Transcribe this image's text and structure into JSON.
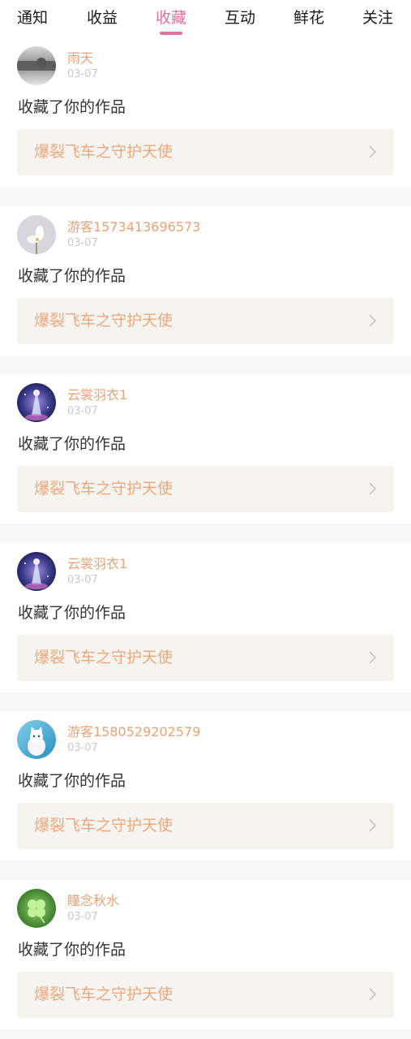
{
  "tabs": [
    {
      "label": "通知"
    },
    {
      "label": "收益"
    },
    {
      "label": "收藏",
      "active": true
    },
    {
      "label": "互动"
    },
    {
      "label": "鲜花"
    },
    {
      "label": "关注"
    }
  ],
  "colors": {
    "accent": "#e0719b",
    "username": "#e8a274",
    "work_title": "#eba87f",
    "work_bg": "#f5f4ef"
  },
  "feed": [
    {
      "user": "雨天",
      "date": "03-07",
      "action": "收藏了你的作品",
      "work": "爆裂飞车之守护天使",
      "avatar": "grayscale-photo-avatar"
    },
    {
      "user": "游客1573413696573",
      "date": "03-07",
      "action": "收藏了你的作品",
      "work": "爆裂飞车之守护天使",
      "avatar": "white-flower-avatar"
    },
    {
      "user": "云裳羽衣1",
      "date": "03-07",
      "action": "收藏了你的作品",
      "work": "爆裂飞车之守护天使",
      "avatar": "galaxy-angel-avatar"
    },
    {
      "user": "云裳羽衣1",
      "date": "03-07",
      "action": "收藏了你的作品",
      "work": "爆裂飞车之守护天使",
      "avatar": "galaxy-angel-avatar"
    },
    {
      "user": "游客1580529202579",
      "date": "03-07",
      "action": "收藏了你的作品",
      "work": "爆裂飞车之守护天使",
      "avatar": "white-cat-avatar"
    },
    {
      "user": "瞳念秋水",
      "date": "03-07",
      "action": "收藏了你的作品",
      "work": "爆裂飞车之守护天使",
      "avatar": "four-leaf-clover-avatar"
    }
  ]
}
